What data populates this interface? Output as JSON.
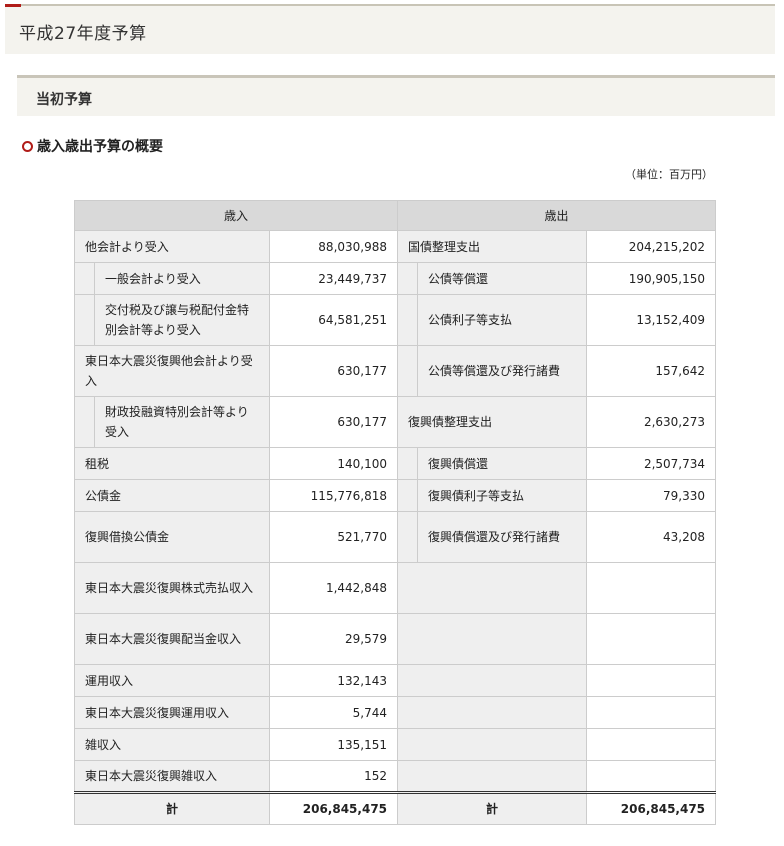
{
  "page": {
    "title": "平成27年度予算"
  },
  "section": {
    "title": "当初予算"
  },
  "heading": {
    "text": "歳入歳出予算の概要"
  },
  "unit": "（単位：百万円）",
  "table": {
    "revenue_header": "歳入",
    "expenditure_header": "歳出",
    "rows": [
      {
        "rev_label": "他会計より受入",
        "rev_value": "88,030,988",
        "exp_label": "国債整理支出",
        "exp_value": "204,215,202"
      },
      {
        "rev_label": "一般会計より受入",
        "rev_value": "23,449,737",
        "exp_label": "公債等償還",
        "exp_value": "190,905,150"
      },
      {
        "rev_label": "交付税及び譲与税配付金特別会計等より受入",
        "rev_value": "64,581,251",
        "exp_label": "公債利子等支払",
        "exp_value": "13,152,409"
      },
      {
        "rev_label": "東日本大震災復興他会計より受入",
        "rev_value": "630,177",
        "exp_label": "公債等償還及び発行諸費",
        "exp_value": "157,642"
      },
      {
        "rev_label": "財政投融資特別会計等より受入",
        "rev_value": "630,177",
        "exp_label": "復興債整理支出",
        "exp_value": "2,630,273"
      },
      {
        "rev_label": "租税",
        "rev_value": "140,100",
        "exp_label": "復興債償還",
        "exp_value": "2,507,734"
      },
      {
        "rev_label": "公債金",
        "rev_value": "115,776,818",
        "exp_label": "復興債利子等支払",
        "exp_value": "79,330"
      },
      {
        "rev_label": "復興借換公債金",
        "rev_value": "521,770",
        "exp_label": "復興債償還及び発行諸費",
        "exp_value": "43,208"
      },
      {
        "rev_label": "東日本大震災復興株式売払収入",
        "rev_value": "1,442,848"
      },
      {
        "rev_label": "東日本大震災復興配当金収入",
        "rev_value": "29,579"
      },
      {
        "rev_label": "運用収入",
        "rev_value": "132,143"
      },
      {
        "rev_label": "東日本大震災復興運用収入",
        "rev_value": "5,744"
      },
      {
        "rev_label": "雑収入",
        "rev_value": "135,151"
      },
      {
        "rev_label": "東日本大震災復興雑収入",
        "rev_value": "152"
      }
    ],
    "total": {
      "rev_label": "計",
      "rev_value": "206,845,475",
      "exp_label": "計",
      "exp_value": "206,845,475"
    }
  }
}
